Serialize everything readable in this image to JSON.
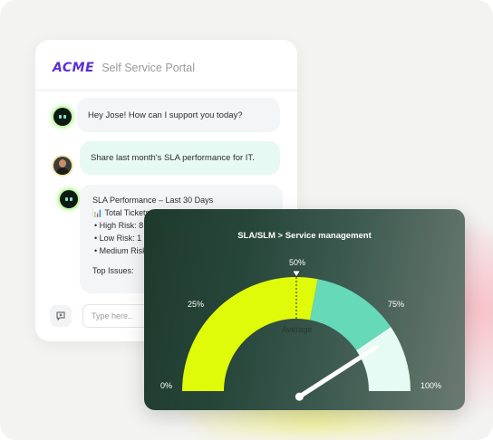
{
  "chat": {
    "brand": "ACME",
    "portal_title": "Self Service Portal",
    "messages": {
      "greeting": "Hey Jose! How can I support you today?",
      "request": "Share last month's SLA performance for IT."
    },
    "sla_summary": {
      "heading": "SLA Performance – Last 30 Days",
      "total": "📊 Total Tickets",
      "high": "•  High Risk: 8",
      "low": "•  Low Risk: 1",
      "medium": "•  Medium Risk",
      "top_issues": "Top Issues:"
    },
    "input_placeholder": "Type here..",
    "icons": {
      "bot": "bot-avatar-icon",
      "user": "user-avatar",
      "attach": "chat-plus-icon"
    }
  },
  "gauge": {
    "title": "SLA/SLM > Service management",
    "center_label": "Average",
    "tick_labels": {
      "t0": "0%",
      "t25": "25%",
      "t50": "50%",
      "t75": "75%",
      "t100": "100%"
    },
    "segments": [
      {
        "from": 0,
        "to": 56,
        "color": "#e0fb0a"
      },
      {
        "from": 56,
        "to": 81,
        "color": "#66d9b8"
      },
      {
        "from": 81,
        "to": 100,
        "color": "#e6fbf3"
      }
    ],
    "marker_value": 50,
    "needle_value": 84
  },
  "colors": {
    "brand": "#5b2fd1",
    "user_bubble": "#e6f9f2",
    "bot_bubble": "#f4f5f7",
    "card_dark": "#1d3a2c"
  }
}
